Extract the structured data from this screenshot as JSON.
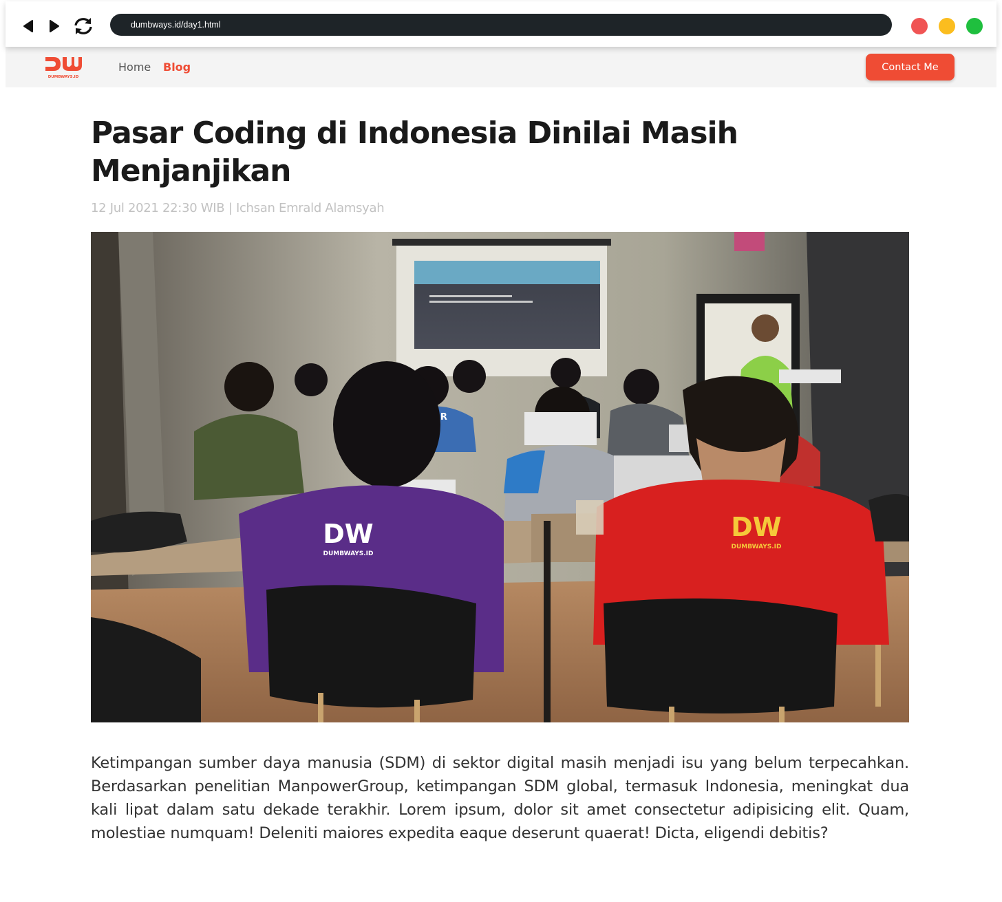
{
  "browser": {
    "url": "dumbways.id/day1.html",
    "icons": {
      "back": "back-arrow-icon",
      "forward": "forward-arrow-icon",
      "reload": "reload-icon"
    },
    "window_dots": [
      "#f05454",
      "#fbbd1f",
      "#1fbf3e"
    ]
  },
  "header": {
    "logo": "DW",
    "logo_caption": "DUMBWAYS.ID",
    "nav": [
      {
        "label": "Home",
        "active": false
      },
      {
        "label": "Blog",
        "active": true
      }
    ],
    "contact_label": "Contact Me",
    "accent_color": "#ef4c34"
  },
  "article": {
    "title": "Pasar Coding di Indonesia Dinilai Masih Menjanjikan",
    "meta": "12 Jul 2021 22:30 WIB | Ichsan Emrald Alamsyah",
    "body": "Ketimpangan sumber daya manusia (SDM) di sektor digital masih menjadi isu yang belum terpecahkan. Berdasarkan penelitian ManpowerGroup, ketimpangan SDM global, termasuk Indonesia, meningkat dua kali lipat dalam satu dekade terakhir. Lorem ipsum, dolor sit amet consectetur adipisicing elit. Quam, molestiae numquam! Deleniti maiores expedita eaque deserunt quaerat! Dicta, eligendi debitis?",
    "image_texts": {
      "shirt_left_logo": "DW",
      "shirt_left_caption": "DUMBWAYS.ID",
      "shirt_right_logo": "DW",
      "shirt_right_caption": "DUMBWAYS.ID",
      "jersey": "INAR"
    }
  }
}
